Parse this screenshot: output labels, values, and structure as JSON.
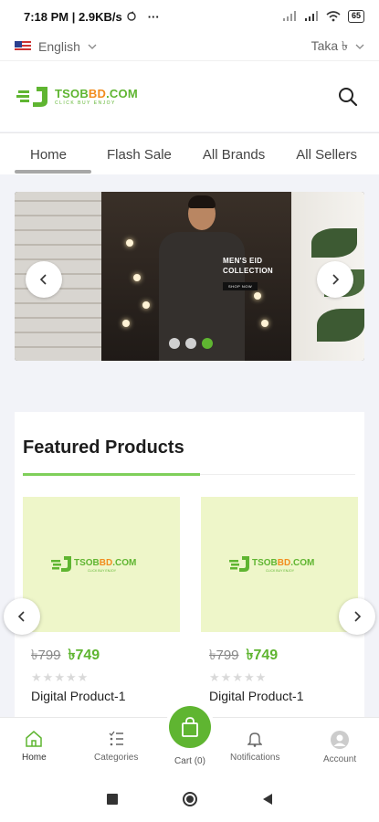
{
  "status": {
    "time_speed": "7:18 PM | 2.9KB/s",
    "more": "···",
    "battery": "65"
  },
  "topbar": {
    "language": "English",
    "currency": "Taka ৳"
  },
  "brand": {
    "name_green": "TSOB",
    "name_orange": "BD",
    "name_rest": ".COM",
    "tagline": "CLICK BUY ENJOY",
    "green": "#5fb531",
    "orange": "#f28c1e"
  },
  "nav": {
    "items": [
      "Home",
      "Flash Sale",
      "All Brands",
      "All Sellers"
    ]
  },
  "banner": {
    "title_line1": "MEN'S EID",
    "title_line2": "COLLECTION",
    "button": "SHOP NOW",
    "slide_count": 3,
    "active_slide": 3
  },
  "featured": {
    "title": "Featured Products",
    "products": [
      {
        "old_price": "৳799",
        "price": "৳749",
        "name": "Digital Product-1",
        "rating": 0
      },
      {
        "old_price": "৳799",
        "price": "৳749",
        "name": "Digital Product-1",
        "rating": 0
      }
    ]
  },
  "bottom_nav": {
    "home": "Home",
    "categories": "Categories",
    "cart": "Cart (0)",
    "notifications": "Notifications",
    "account": "Account"
  }
}
